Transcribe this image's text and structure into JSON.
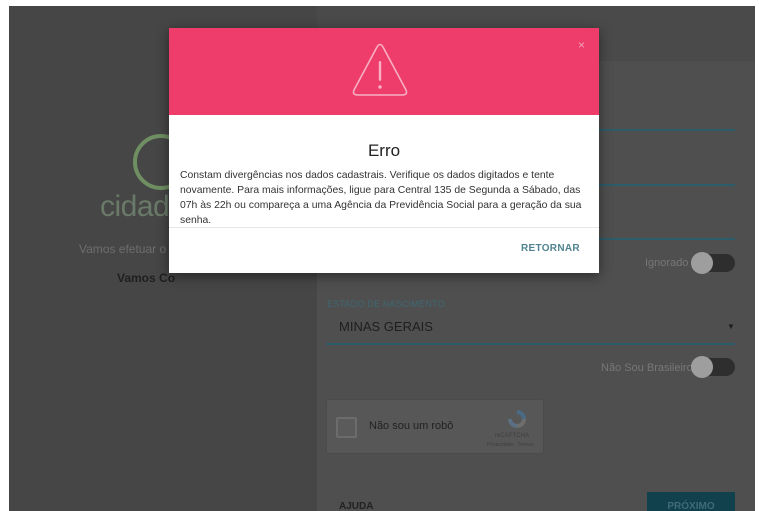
{
  "background_form": {
    "logo_text": "cidadã",
    "welcome_text": "Vamos efetuar o",
    "welcome_bold": "Vamos Co",
    "toggle_ignored_label": "Ignorado",
    "estado_label": "ESTADO DE NASCIMENTO",
    "estado_value": "MINAS GERAIS",
    "toggle_brazilian_label": "Não Sou Brasileiro",
    "captcha_text": "Não sou um robô",
    "captcha_brand": "reCAPTCHA",
    "captcha_links": "Privacidade - Termos",
    "help_label": "AJUDA",
    "next_label": "PRÓXIMO"
  },
  "modal": {
    "close_icon": "×",
    "title": "Erro",
    "message": "Constam divergências nos dados cadastrais. Verifique os dados digitados e tente novamente. Para mais informações, ligue para Central 135 de Segunda a Sábado, das 07h às 22h ou compareça a uma Agência da Previdência Social para a geração da sua senha.",
    "button_label": "RETORNAR",
    "header_color": "#ee3c6b",
    "icon": "warning-triangle-icon"
  }
}
